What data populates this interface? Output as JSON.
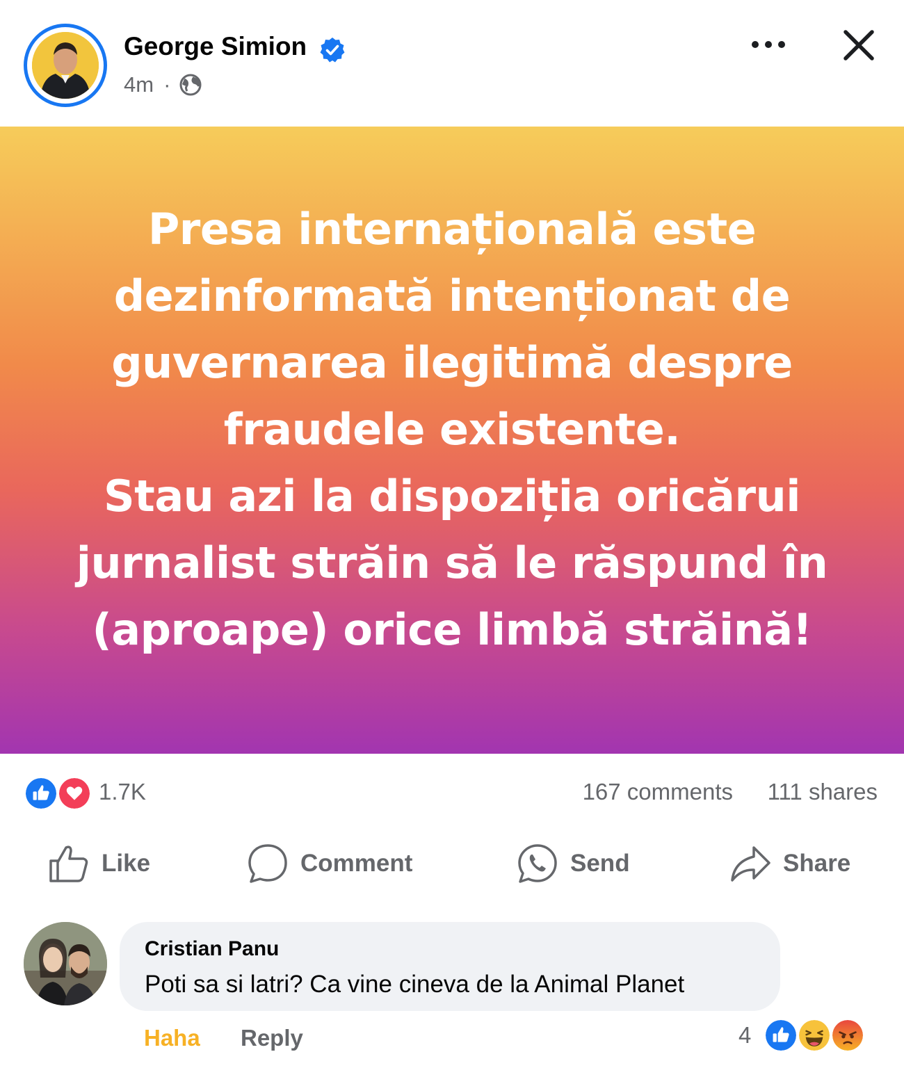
{
  "post": {
    "author": "George Simion",
    "time": "4m",
    "separator": "·",
    "status_text": "Presa internațională este\ndezinformată intenționat de\nguvernarea ilegitimă despre\nfraudele existente.\nStau azi la dispoziția oricărui\njurnalist străin să le răspund în\n(aproape) orice limbă străină!",
    "colors": {
      "accent": "#1877F2",
      "gradient_top": "#f6cc5a",
      "gradient_bottom": "#a235b0"
    }
  },
  "summary": {
    "reaction_icons": [
      "like-icon",
      "love-icon"
    ],
    "reaction_count": "1.7K",
    "comments": "167 comments",
    "shares": "111 shares"
  },
  "actions": {
    "like": "Like",
    "comment": "Comment",
    "send": "Send",
    "share": "Share"
  },
  "comment": {
    "author": "Cristian Panu",
    "text": "Poti sa si latri? Ca vine cineva de la Animal Planet",
    "reaction_label": "Haha",
    "reply_label": "Reply",
    "reaction_count": "4",
    "reaction_icons": [
      "like-icon",
      "haha-icon",
      "angry-icon"
    ]
  }
}
